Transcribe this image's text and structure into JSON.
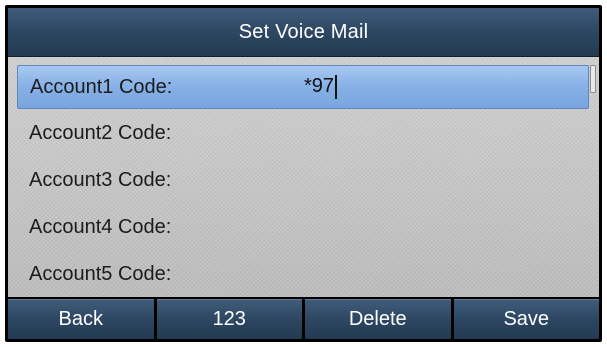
{
  "title": "Set Voice Mail",
  "rows": [
    {
      "label": "Account1 Code:",
      "value": "*97"
    },
    {
      "label": "Account2 Code:",
      "value": ""
    },
    {
      "label": "Account3 Code:",
      "value": ""
    },
    {
      "label": "Account4 Code:",
      "value": ""
    },
    {
      "label": "Account5 Code:",
      "value": ""
    }
  ],
  "softkeys": {
    "back": "Back",
    "input_mode": "123",
    "delete": "Delete",
    "save": "Save"
  },
  "colors": {
    "title_bar": "#2c4560",
    "selected_row": "#86b0e6",
    "background": "#c9c9c9"
  }
}
